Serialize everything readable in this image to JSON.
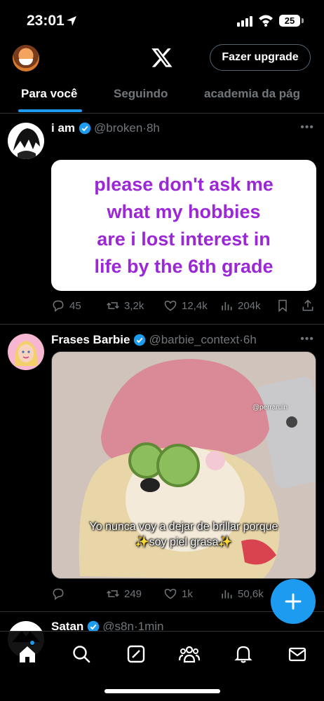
{
  "status_bar": {
    "time": "23:01",
    "battery": "25"
  },
  "header": {
    "upgrade_label": "Fazer upgrade"
  },
  "tabs": [
    {
      "label": "Para você",
      "active": true
    },
    {
      "label": "Seguindo",
      "active": false
    },
    {
      "label": "academia da pág",
      "active": false
    }
  ],
  "tweets": [
    {
      "name": "i am",
      "handle": "@broken",
      "time": "8h",
      "text_card": [
        "please don't ask me",
        "what my hobbies",
        "are i lost interest in",
        "life by the 6th grade"
      ],
      "replies": "45",
      "reposts": "3,2k",
      "likes": "12,4k",
      "views": "204k"
    },
    {
      "name": "Frases Barbie",
      "handle": "@barbie_context",
      "time": "6h",
      "image_watermark": "@perraruin",
      "image_caption": [
        "Yo nunca voy a dejar de brillar porque",
        "✨soy piel grasa✨"
      ],
      "replies": "",
      "reposts": "249",
      "likes": "1k",
      "views": "50,6k"
    },
    {
      "name": "Satan",
      "handle": "@s8n",
      "time": "1min"
    }
  ],
  "nav": [
    "home-icon",
    "search-icon",
    "grok-icon",
    "communities-icon",
    "notifications-icon",
    "messages-icon"
  ],
  "colors": {
    "accent": "#1d9bf0",
    "card_text": "#9c27d6",
    "muted": "#71767b"
  }
}
